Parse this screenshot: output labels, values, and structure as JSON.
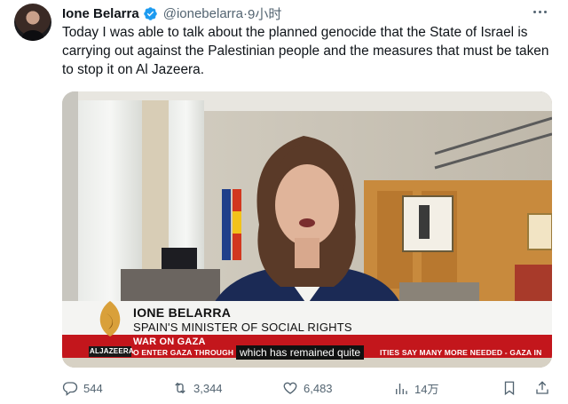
{
  "author": {
    "name": "Ione Belarra",
    "handle": "@ionebelarra",
    "separator": "·",
    "time": "9小时"
  },
  "tweet": {
    "text": "Today I was able to talk about the planned genocide that the State of Israel is carrying out against the Palestinian people and the measures that must be taken to stop it on Al Jazeera."
  },
  "video": {
    "lower_third": {
      "name": "IONE BELARRA",
      "title": "SPAIN'S MINISTER OF SOCIAL RIGHTS",
      "section": "WAR ON GAZA"
    },
    "ticker": {
      "channel": "ALJAZEERA",
      "left_text": "O ENTER GAZA THROUGH F",
      "right_text": "ITIES SAY MANY MORE NEEDED  -  GAZA IN"
    },
    "subtitle": "which has remained quite"
  },
  "actions": {
    "replies": "544",
    "reposts": "3,344",
    "likes": "6,483",
    "views": "14万"
  },
  "icons": {
    "verified": "verified-badge-icon",
    "more": "more-icon",
    "reply": "reply-icon",
    "repost": "repost-icon",
    "like": "heart-icon",
    "views": "views-icon",
    "bookmark": "bookmark-icon",
    "share": "share-icon"
  },
  "colors": {
    "verified": "#1d9bf0",
    "secondary_text": "#536471",
    "aljazeera_red": "#c3161c",
    "aljazeera_gold": "#d9a03a"
  }
}
